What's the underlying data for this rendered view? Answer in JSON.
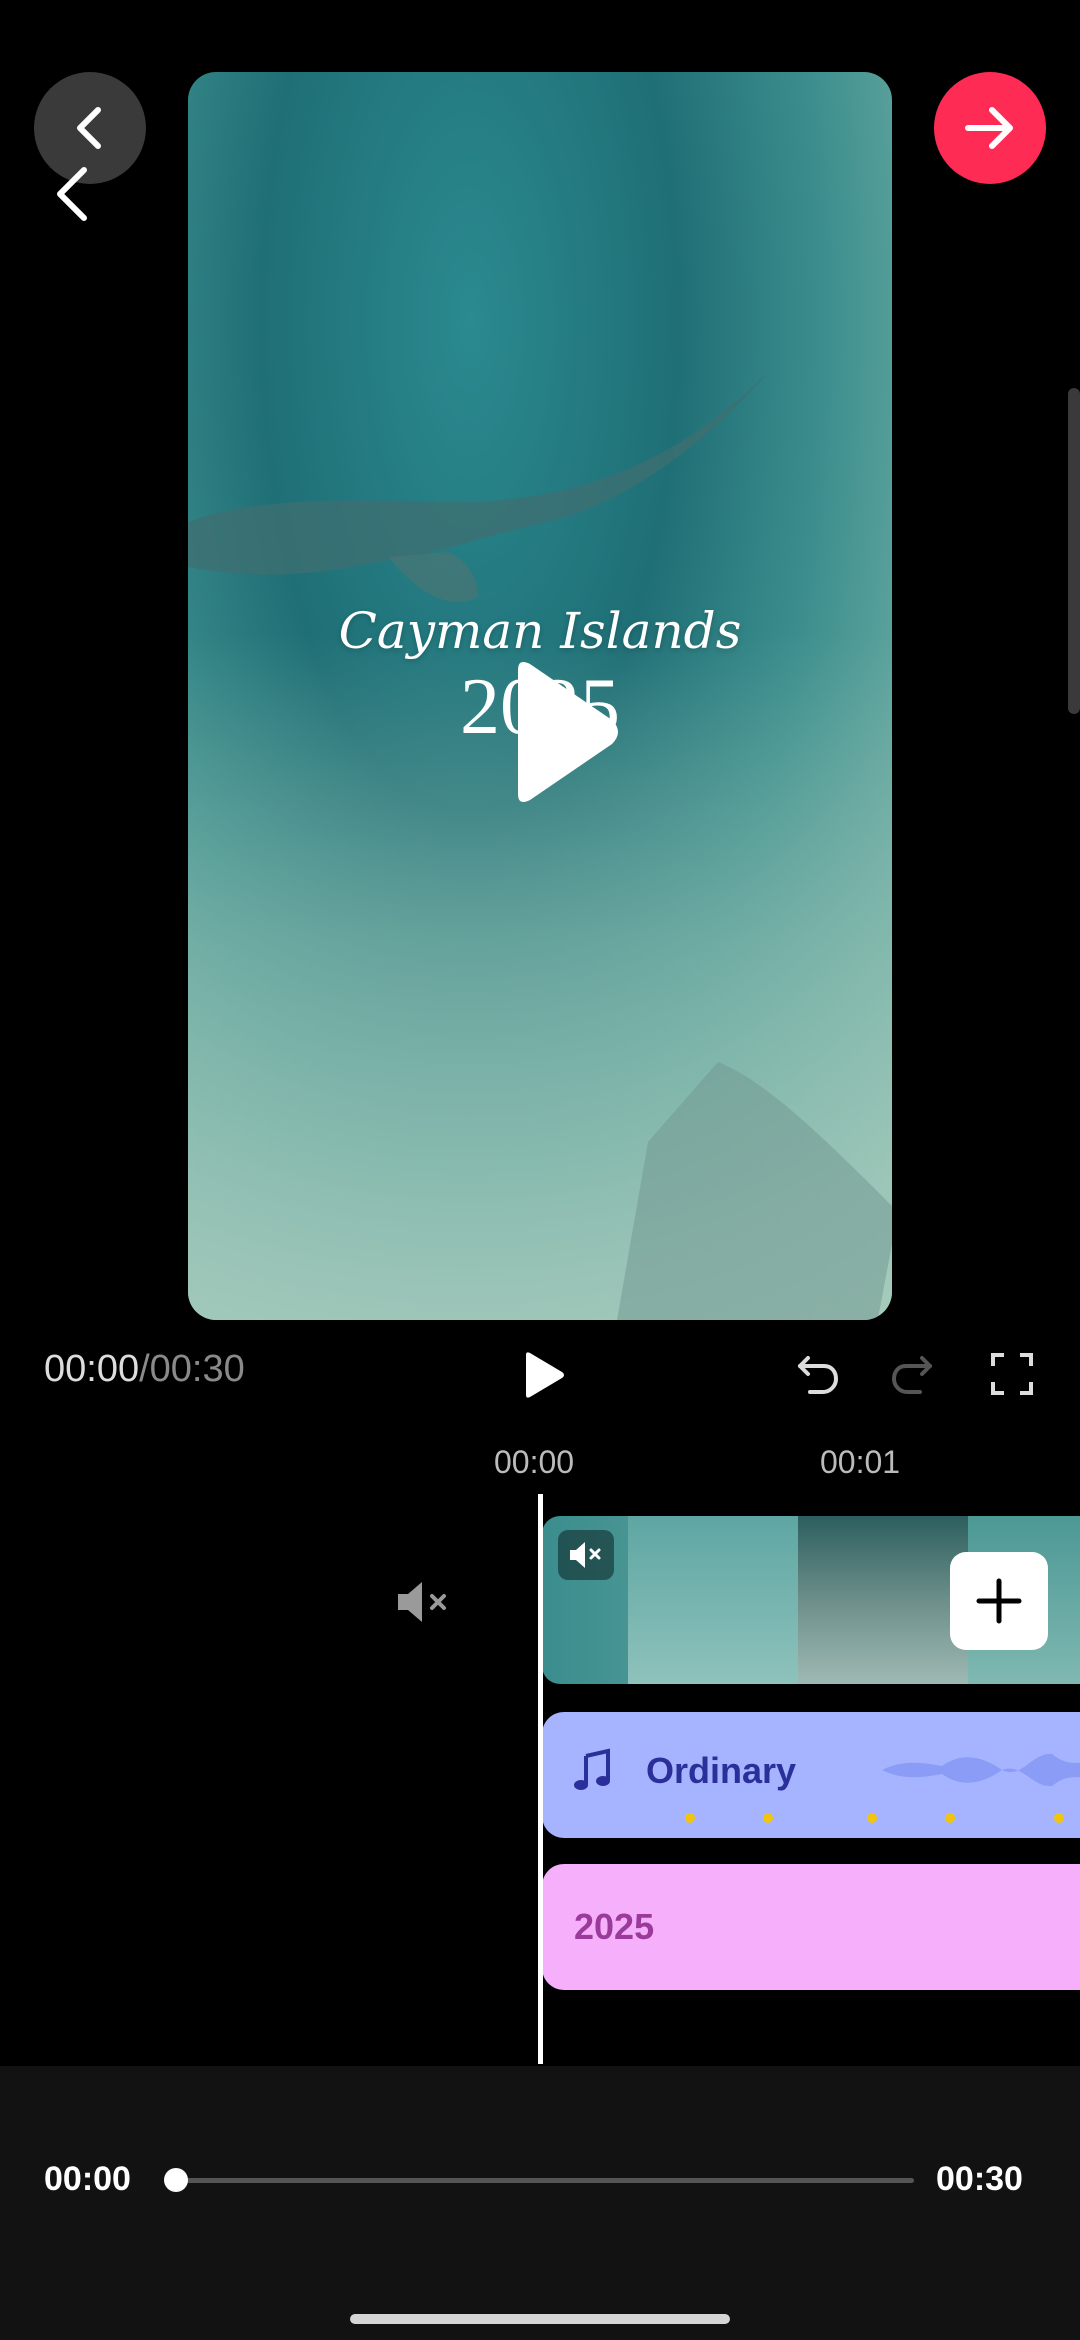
{
  "preview": {
    "title_line1": "Cayman Islands",
    "title_line2": "2025"
  },
  "playback": {
    "current_time": "00:00",
    "separator": "/",
    "total_time": "00:30"
  },
  "ruler": {
    "ticks": [
      "00:00",
      "00:01"
    ]
  },
  "tracks": {
    "music_label": "Ordinary",
    "text_label": "2025"
  },
  "scrubber": {
    "start_time": "00:00",
    "end_time": "00:30",
    "progress_fraction": 0
  },
  "colors": {
    "next_button": "#fe2c55",
    "music_track": "#a6b4ff",
    "text_track": "#f6b0fb",
    "beat_marker": "#f1c40f"
  },
  "icons": {
    "back": "chevron-left-icon",
    "next": "arrow-right-icon",
    "play": "play-icon",
    "undo": "undo-icon",
    "redo": "redo-icon",
    "fullscreen": "fullscreen-icon",
    "mute": "mute-icon",
    "add": "plus-icon",
    "music": "music-note-icon"
  }
}
